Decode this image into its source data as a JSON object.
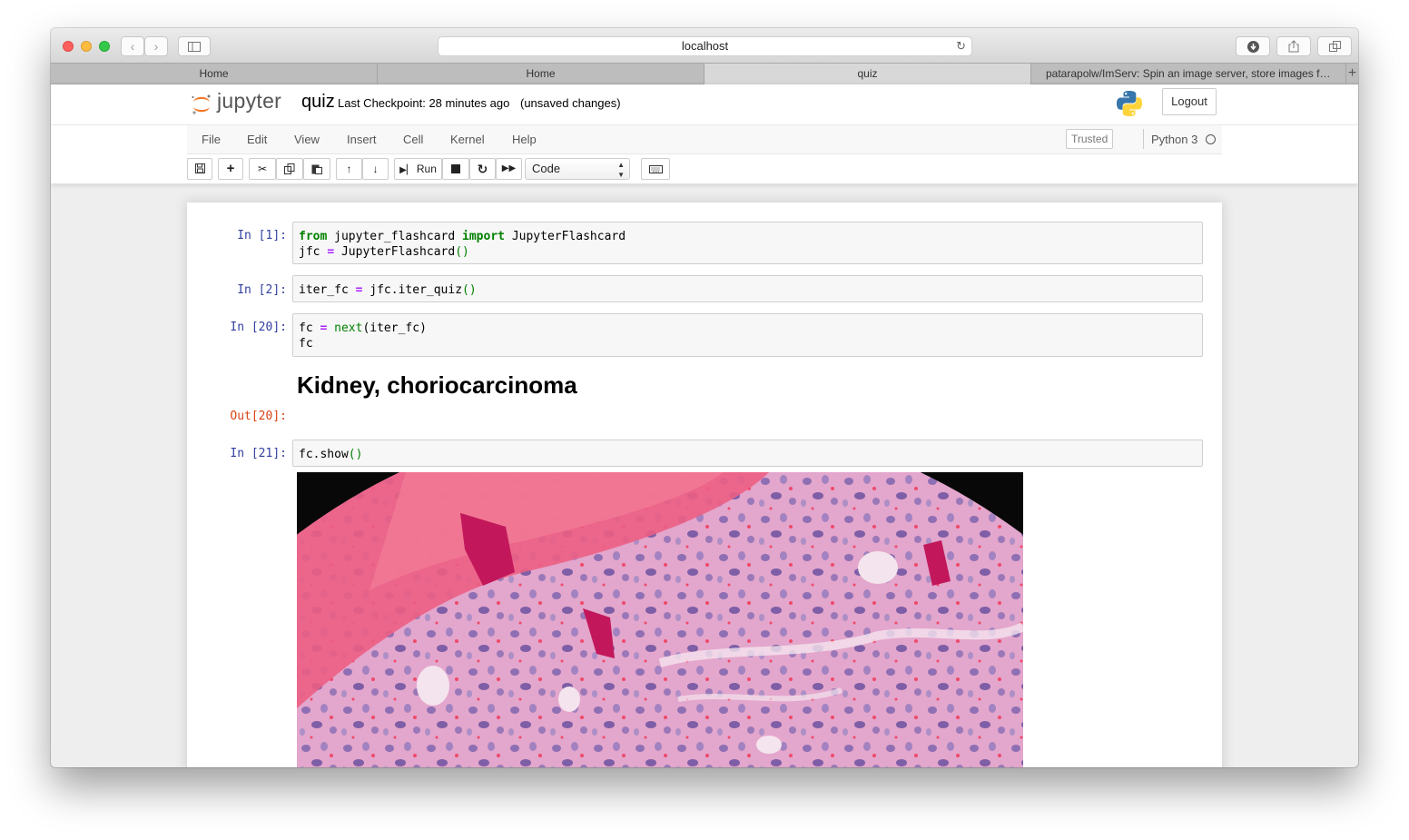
{
  "browser": {
    "url": "localhost",
    "tabs": [
      {
        "label": "Home",
        "active": false
      },
      {
        "label": "Home",
        "active": false
      },
      {
        "label": "quiz",
        "active": true
      },
      {
        "label": "patarapolw/ImServ: Spin an image server, store images fro...",
        "active": false
      }
    ],
    "new_tab_label": "+"
  },
  "header": {
    "logo_text": "jupyter",
    "notebook_name": "quiz",
    "checkpoint": "Last Checkpoint: 28 minutes ago",
    "save_status": "(unsaved changes)",
    "logout_label": "Logout"
  },
  "menu": {
    "items": [
      "File",
      "Edit",
      "View",
      "Insert",
      "Cell",
      "Kernel",
      "Help"
    ],
    "trusted_label": "Trusted",
    "kernel_name": "Python 3"
  },
  "toolbar": {
    "run_label": "Run",
    "cell_type": "Code",
    "icons": [
      "save-icon",
      "plus-icon",
      "cut-icon",
      "copy-icon",
      "paste-icon",
      "arrow-up-icon",
      "arrow-down-icon",
      "step-forward-icon",
      "stop-icon",
      "restart-icon",
      "fast-forward-icon",
      "keyboard-icon"
    ]
  },
  "cells": [
    {
      "prompt": "In [1]:"
    },
    {
      "prompt": "In [2]:"
    },
    {
      "prompt": "In [20]:"
    },
    {
      "out_prompt": "Out[20]:",
      "output_heading": "Kidney, choriocarcinoma"
    },
    {
      "prompt": "In [21]:"
    }
  ],
  "code": {
    "c1_l1": [
      {
        "t": "from",
        "c": "kw"
      },
      {
        "t": " jupyter_flashcard ",
        "c": ""
      },
      {
        "t": "import",
        "c": "kw"
      },
      {
        "t": " JupyterFlashcard",
        "c": ""
      }
    ],
    "c1_l2": [
      {
        "t": "jfc ",
        "c": ""
      },
      {
        "t": "=",
        "c": "op"
      },
      {
        "t": " JupyterFlashcard",
        "c": ""
      },
      {
        "t": "()",
        "c": "par"
      }
    ],
    "c2_l1": [
      {
        "t": "iter_fc ",
        "c": ""
      },
      {
        "t": "=",
        "c": "op"
      },
      {
        "t": " jfc.iter_quiz",
        "c": ""
      },
      {
        "t": "()",
        "c": "par"
      }
    ],
    "c3_l1": [
      {
        "t": "fc ",
        "c": ""
      },
      {
        "t": "=",
        "c": "op"
      },
      {
        "t": " ",
        "c": ""
      },
      {
        "t": "next",
        "c": "bi"
      },
      {
        "t": "(iter_fc)",
        "c": ""
      }
    ],
    "c3_l2": [
      {
        "t": "fc",
        "c": ""
      }
    ],
    "c4_l1": [
      {
        "t": "fc.show",
        "c": ""
      },
      {
        "t": "()",
        "c": "par"
      }
    ]
  },
  "image": {
    "subject": "H&E histology micrograph, Kidney choriocarcinoma"
  },
  "colors": {
    "prompt_in": "#303f9f",
    "prompt_out": "#d84315",
    "keyword": "#008000",
    "operator": "#aa22ff",
    "tissue_pink": "#e8a0c8",
    "blood_red": "#ef4a6b",
    "nuclei_purple": "#9a78b8"
  }
}
